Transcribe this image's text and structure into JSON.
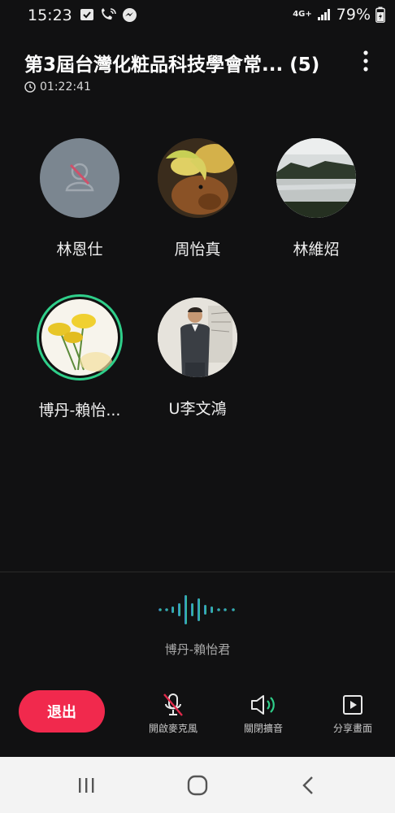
{
  "status": {
    "time": "15:23",
    "network": "4G+",
    "battery": "79%"
  },
  "header": {
    "title": "第3屆台灣化粧品科技學會常... (5)",
    "duration": "01:22:41"
  },
  "participants": [
    {
      "name": "林恩仕",
      "avatar": "default-person-muted"
    },
    {
      "name": "周怡真",
      "avatar": "dog-photo"
    },
    {
      "name": "林維炤",
      "avatar": "lake-photo"
    },
    {
      "name": "博丹-賴怡...",
      "avatar": "yellow-flowers-photo",
      "speaking": true
    },
    {
      "name": "U李文鴻",
      "avatar": "man-in-suit-photo"
    }
  ],
  "active_speaker": {
    "name": "博丹-賴怡君"
  },
  "controls": {
    "leave": "退出",
    "mic": "開啟麥克風",
    "speaker": "關閉擴音",
    "share": "分享畫面"
  },
  "colors": {
    "background": "#111112",
    "leave": "#f1294d",
    "accent": "#2fcf8a"
  }
}
